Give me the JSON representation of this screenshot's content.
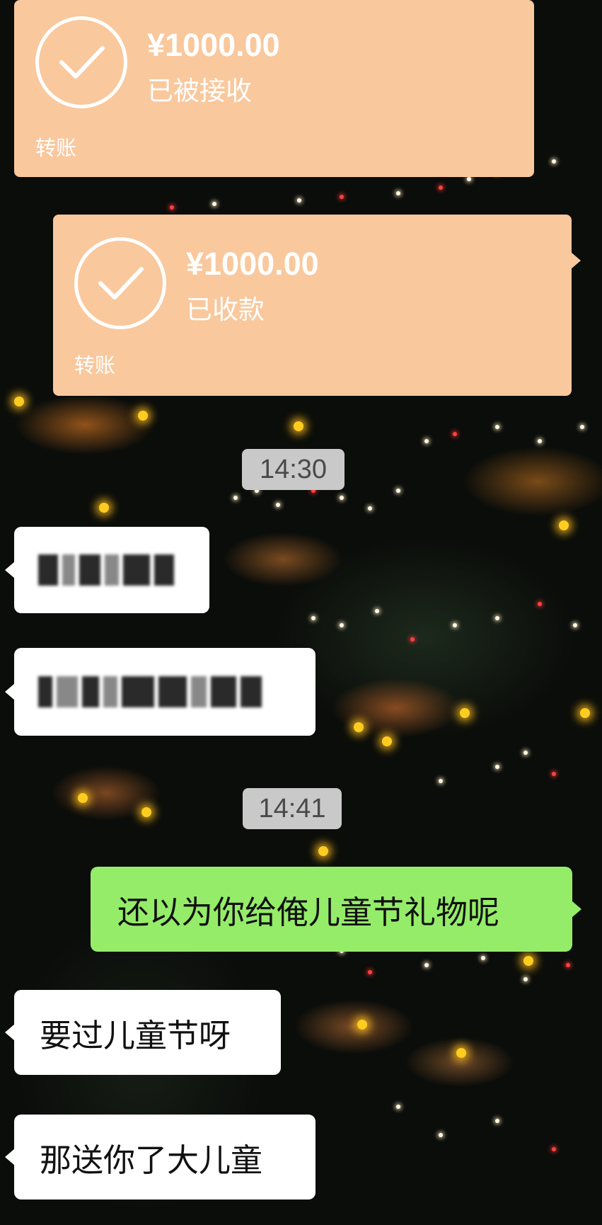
{
  "transfers": [
    {
      "amount": "¥1000.00",
      "status": "已被接收",
      "label": "转账"
    },
    {
      "amount": "¥1000.00",
      "status": "已收款",
      "label": "转账"
    }
  ],
  "timestamps": [
    "14:30",
    "14:41"
  ],
  "messages": [
    {
      "side": "in",
      "text": "",
      "redacted": true
    },
    {
      "side": "in",
      "text": "",
      "redacted": true
    },
    {
      "side": "out",
      "text": "还以为你给俺儿童节礼物呢"
    },
    {
      "side": "in",
      "text": "要过儿童节呀"
    },
    {
      "side": "in",
      "text": "那送你了大儿童"
    }
  ],
  "colors": {
    "transfer_bg": "#f9c89d",
    "outgoing_bubble": "#95ec69",
    "incoming_bubble": "#ffffff",
    "timestamp_bg": "#c9c9c9"
  }
}
